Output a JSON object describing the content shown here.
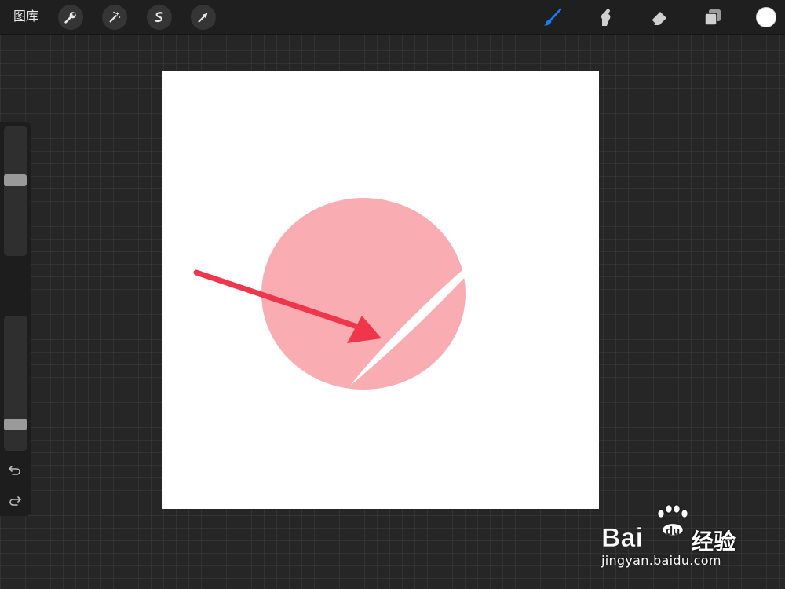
{
  "topbar": {
    "gallery_label": "图库",
    "left_tools": [
      "wrench-icon",
      "magic-wand-icon",
      "selection-icon",
      "transform-arrow-icon"
    ],
    "right_tools": [
      "brush-icon",
      "smudge-icon",
      "eraser-icon",
      "layers-icon"
    ],
    "active_tool": "brush-icon",
    "accent_color": "#1a7cf5",
    "current_color": "#ffffff"
  },
  "sidebar": {
    "brush_size_level": 0.6,
    "opacity_level": 0.15,
    "icons": [
      "modify-square-icon",
      "undo-icon",
      "redo-icon"
    ]
  },
  "canvas": {
    "background": "#ffffff",
    "shape_color": "#f9adb3",
    "annotation_arrow_color": "#f0364a"
  },
  "watermark": {
    "brand_text": "经验",
    "url": "jingyan.baidu.com"
  }
}
